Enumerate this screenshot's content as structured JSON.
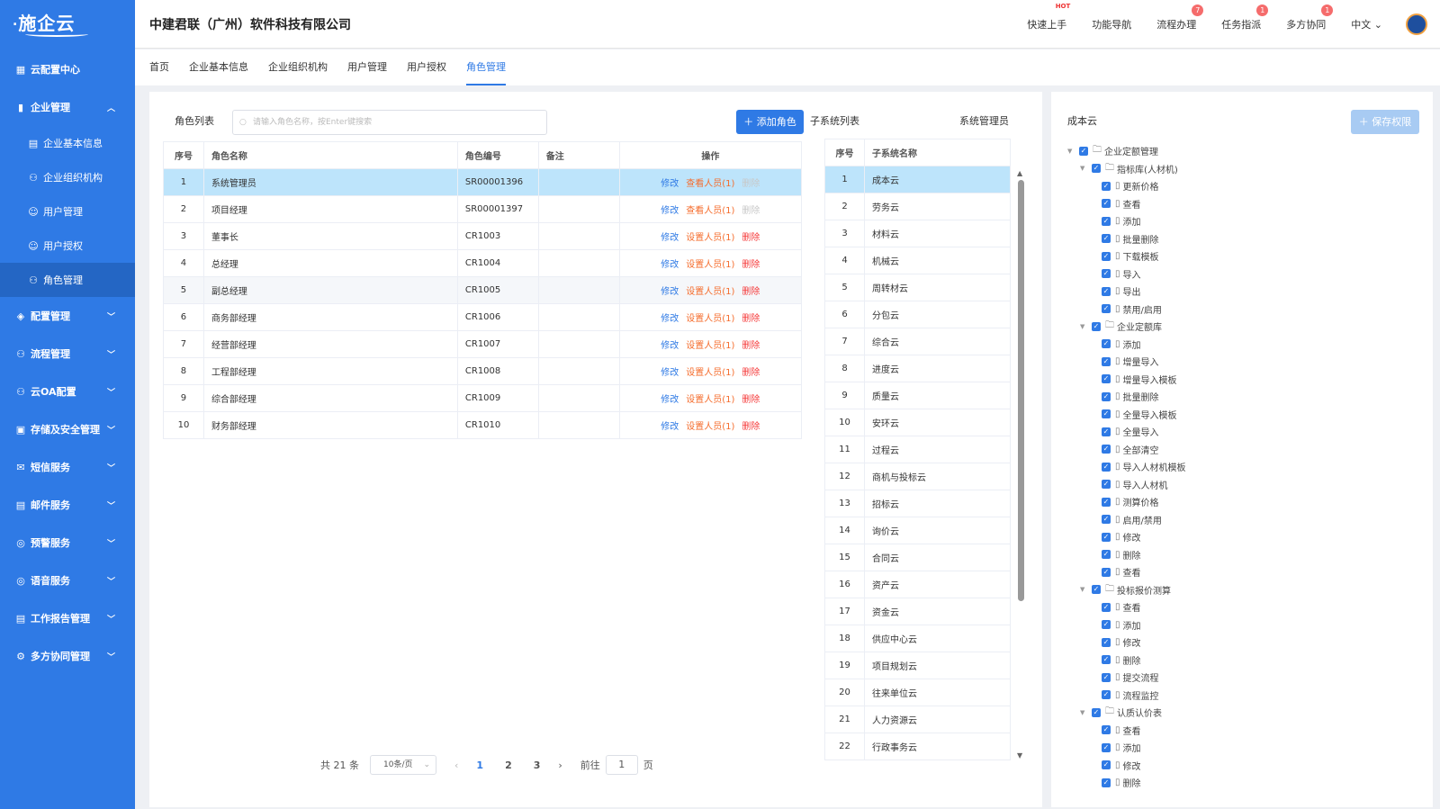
{
  "brand": {
    "logo": "施企云"
  },
  "header": {
    "company": "中建君联（广州）软件科技有限公司",
    "items": [
      {
        "label": "快速上手",
        "badge": "HOT"
      },
      {
        "label": "功能导航",
        "badge": ""
      },
      {
        "label": "流程办理",
        "badge": "7"
      },
      {
        "label": "任务指派",
        "badge": "1"
      },
      {
        "label": "多方协同",
        "badge": "1"
      }
    ],
    "lang": "中文"
  },
  "sidebar": {
    "top": "云配置中心",
    "group": "企业管理",
    "subs": [
      "企业基本信息",
      "企业组织机构",
      "用户管理",
      "用户授权",
      "角色管理"
    ],
    "items": [
      "配置管理",
      "流程管理",
      "云OA配置",
      "存储及安全管理",
      "短信服务",
      "邮件服务",
      "预警服务",
      "语音服务",
      "工作报告管理",
      "多方协同管理"
    ]
  },
  "tabs": [
    "首页",
    "企业基本信息",
    "企业组织机构",
    "用户管理",
    "用户授权",
    "角色管理"
  ],
  "roles": {
    "title": "角色列表",
    "search_placeholder": "请输入角色名称，按Enter键搜索",
    "add_label": "添加角色",
    "columns": [
      "序号",
      "角色名称",
      "角色编号",
      "备注",
      "操作"
    ],
    "rows": [
      {
        "no": "1",
        "name": "系统管理员",
        "code": "SR00001396",
        "remark": "",
        "edit": "修改",
        "person": "查看人员(1)",
        "del": "删除"
      },
      {
        "no": "2",
        "name": "项目经理",
        "code": "SR00001397",
        "remark": "",
        "edit": "修改",
        "person": "查看人员(1)",
        "del": "删除"
      },
      {
        "no": "3",
        "name": "董事长",
        "code": "CR1003",
        "remark": "",
        "edit": "修改",
        "person": "设置人员(1)",
        "del": "删除"
      },
      {
        "no": "4",
        "name": "总经理",
        "code": "CR1004",
        "remark": "",
        "edit": "修改",
        "person": "设置人员(1)",
        "del": "删除"
      },
      {
        "no": "5",
        "name": "副总经理",
        "code": "CR1005",
        "remark": "",
        "edit": "修改",
        "person": "设置人员(1)",
        "del": "删除"
      },
      {
        "no": "6",
        "name": "商务部经理",
        "code": "CR1006",
        "remark": "",
        "edit": "修改",
        "person": "设置人员(1)",
        "del": "删除"
      },
      {
        "no": "7",
        "name": "经营部经理",
        "code": "CR1007",
        "remark": "",
        "edit": "修改",
        "person": "设置人员(1)",
        "del": "删除"
      },
      {
        "no": "8",
        "name": "工程部经理",
        "code": "CR1008",
        "remark": "",
        "edit": "修改",
        "person": "设置人员(1)",
        "del": "删除"
      },
      {
        "no": "9",
        "name": "综合部经理",
        "code": "CR1009",
        "remark": "",
        "edit": "修改",
        "person": "设置人员(1)",
        "del": "删除"
      },
      {
        "no": "10",
        "name": "财务部经理",
        "code": "CR1010",
        "remark": "",
        "edit": "修改",
        "person": "设置人员(1)",
        "del": "删除"
      }
    ]
  },
  "pager": {
    "total": "共 21 条",
    "size": "10条/页",
    "pages": [
      "1",
      "2",
      "3"
    ],
    "goto": "前往",
    "page_value": "1",
    "page_unit": "页"
  },
  "subsystems": {
    "title": "子系统列表",
    "role": "系统管理员",
    "columns": [
      "序号",
      "子系统名称"
    ],
    "rows": [
      "成本云",
      "劳务云",
      "材料云",
      "机械云",
      "周转材云",
      "分包云",
      "综合云",
      "进度云",
      "质量云",
      "安环云",
      "过程云",
      "商机与投标云",
      "招标云",
      "询价云",
      "合同云",
      "资产云",
      "资金云",
      "供应中心云",
      "项目规划云",
      "往来单位云",
      "人力资源云",
      "行政事务云"
    ]
  },
  "perms": {
    "title": "成本云",
    "save_label": "保存权限",
    "tree": [
      {
        "lvl": 0,
        "folder": true,
        "label": "企业定额管理"
      },
      {
        "lvl": 1,
        "folder": true,
        "label": "指标库(人材机)"
      },
      {
        "lvl": 2,
        "label": "更新价格"
      },
      {
        "lvl": 2,
        "label": "查看"
      },
      {
        "lvl": 2,
        "label": "添加"
      },
      {
        "lvl": 2,
        "label": "批量删除"
      },
      {
        "lvl": 2,
        "label": "下载模板"
      },
      {
        "lvl": 2,
        "label": "导入"
      },
      {
        "lvl": 2,
        "label": "导出"
      },
      {
        "lvl": 2,
        "label": "禁用/启用"
      },
      {
        "lvl": 1,
        "folder": true,
        "label": "企业定额库"
      },
      {
        "lvl": 2,
        "label": "添加"
      },
      {
        "lvl": 2,
        "label": "增量导入"
      },
      {
        "lvl": 2,
        "label": "增量导入模板"
      },
      {
        "lvl": 2,
        "label": "批量删除"
      },
      {
        "lvl": 2,
        "label": "全量导入模板"
      },
      {
        "lvl": 2,
        "label": "全量导入"
      },
      {
        "lvl": 2,
        "label": "全部清空"
      },
      {
        "lvl": 2,
        "label": "导入人材机模板"
      },
      {
        "lvl": 2,
        "label": "导入人材机"
      },
      {
        "lvl": 2,
        "label": "测算价格"
      },
      {
        "lvl": 2,
        "label": "启用/禁用"
      },
      {
        "lvl": 2,
        "label": "修改"
      },
      {
        "lvl": 2,
        "label": "删除"
      },
      {
        "lvl": 2,
        "label": "查看"
      },
      {
        "lvl": 1,
        "folder": true,
        "label": "投标报价测算"
      },
      {
        "lvl": 2,
        "label": "查看"
      },
      {
        "lvl": 2,
        "label": "添加"
      },
      {
        "lvl": 2,
        "label": "修改"
      },
      {
        "lvl": 2,
        "label": "删除"
      },
      {
        "lvl": 2,
        "label": "提交流程"
      },
      {
        "lvl": 2,
        "label": "流程监控"
      },
      {
        "lvl": 1,
        "folder": true,
        "label": "认质认价表"
      },
      {
        "lvl": 2,
        "label": "查看"
      },
      {
        "lvl": 2,
        "label": "添加"
      },
      {
        "lvl": 2,
        "label": "修改"
      },
      {
        "lvl": 2,
        "label": "删除"
      }
    ]
  }
}
